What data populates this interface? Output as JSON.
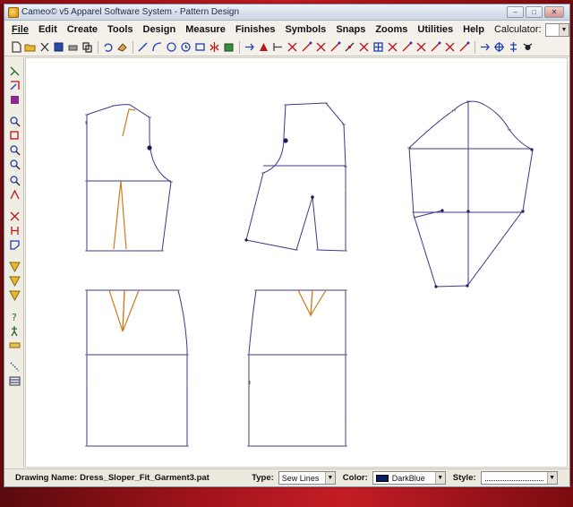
{
  "window": {
    "title": "Cameo© v5 Apparel Software System - Pattern Design",
    "buttons": {
      "minimize": "–",
      "maximize": "□",
      "close": "✕"
    }
  },
  "menubar": {
    "items": [
      {
        "label": "File",
        "icon": ""
      },
      {
        "label": "Edit"
      },
      {
        "label": "Create"
      },
      {
        "label": "Tools"
      },
      {
        "label": "Design"
      },
      {
        "label": "Measure"
      },
      {
        "label": "Finishes"
      },
      {
        "label": "Symbols"
      },
      {
        "label": "Snaps"
      },
      {
        "label": "Zooms"
      },
      {
        "label": "Utilities"
      },
      {
        "label": "Help"
      }
    ],
    "calculator_label": "Calculator:",
    "calculator_value": ""
  },
  "toolbar": {
    "icons": [
      "new-file-icon",
      "open-folder-icon",
      "cut-icon",
      "save-icon",
      "print-icon",
      "copy-icon",
      "undo-icon",
      "eraser-icon",
      "line-icon",
      "curve-icon",
      "circle-icon",
      "clock-icon",
      "rectangle-icon",
      "mirror-icon",
      "box-icon",
      "arrow-icon",
      "triangle-icon",
      "tick-icon",
      "cross-icon",
      "slash-icon",
      "cross-icon",
      "slash-icon",
      "point-icon",
      "cross-icon",
      "grid-icon",
      "cross-icon",
      "slash-icon",
      "cross-icon",
      "slash-icon",
      "cross-icon",
      "slash-icon",
      "arrow-icon",
      "target-icon",
      "pivot-icon",
      "crab-icon"
    ],
    "accent_red": "#c0141a",
    "accent_blue": "#1f3fae"
  },
  "leftbar": {
    "icons": [
      "tool-a-icon",
      "tool-b-icon",
      "tool-c-icon",
      "zoom-icon",
      "zoom-box-icon",
      "zoom-in-icon",
      "zoom-out-icon",
      "zoom-prev-icon",
      "zoom-fit-icon",
      "node-icon",
      "measure-icon",
      "shape-icon",
      "fan-icon",
      "fan-icon",
      "fan-icon",
      "question-icon",
      "walk-icon",
      "ruler-icon",
      "dots-icon",
      "table-icon"
    ]
  },
  "status": {
    "drawing_label": "Drawing Name:",
    "drawing_name": "Dress_Sloper_Fit_Garment3.pat",
    "type_label": "Type:",
    "type_value": "Sew Lines",
    "color_label": "Color:",
    "color_value": "DarkBlue",
    "color_hex": "#0a1a6a",
    "style_label": "Style:"
  },
  "colors": {
    "pattern_line": "#3a3a8a",
    "dart_line": "#d07a1a"
  }
}
